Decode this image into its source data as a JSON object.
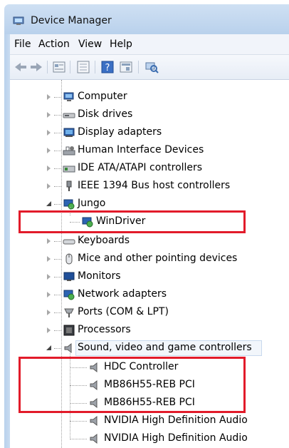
{
  "window": {
    "title": "Device Manager"
  },
  "menu": [
    "File",
    "Action",
    "View",
    "Help"
  ],
  "toolbar_icons": [
    "back-arrow-icon",
    "forward-arrow-icon",
    "properties-sheet-icon",
    "show-hidden-icon",
    "help-icon",
    "view-toggle-icon",
    "scan-hardware-icon"
  ],
  "tree": [
    {
      "label": "Computer",
      "icon": "computer-icon"
    },
    {
      "label": "Disk drives",
      "icon": "disk-drive-icon"
    },
    {
      "label": "Display adapters",
      "icon": "display-adapter-icon"
    },
    {
      "label": "Human Interface Devices",
      "icon": "hid-icon"
    },
    {
      "label": "IDE ATA/ATAPI controllers",
      "icon": "ide-controller-icon"
    },
    {
      "label": "IEEE 1394 Bus host controllers",
      "icon": "ieee1394-icon"
    },
    {
      "label": "Jungo",
      "icon": "jungo-icon",
      "expanded": true
    },
    {
      "label": "WinDriver",
      "icon": "windriver-icon",
      "child": true
    },
    {
      "label": "Keyboards",
      "icon": "keyboard-icon"
    },
    {
      "label": "Mice and other pointing devices",
      "icon": "mouse-icon"
    },
    {
      "label": "Monitors",
      "icon": "monitor-icon"
    },
    {
      "label": "Network adapters",
      "icon": "network-adapter-icon"
    },
    {
      "label": "Ports (COM & LPT)",
      "icon": "port-icon"
    },
    {
      "label": "Processors",
      "icon": "processor-icon"
    },
    {
      "label": "Sound, video and game controllers",
      "icon": "speaker-icon",
      "expanded": true,
      "selected": true
    },
    {
      "label": "HDC Controller",
      "icon": "speaker-icon",
      "child": true
    },
    {
      "label": "MB86H55-REB PCI",
      "icon": "speaker-icon",
      "child": true
    },
    {
      "label": "MB86H55-REB PCI",
      "icon": "speaker-icon",
      "child": true
    },
    {
      "label": "NVIDIA High Definition Audio",
      "icon": "speaker-icon",
      "child": true
    },
    {
      "label": "NVIDIA High Definition Audio",
      "icon": "speaker-icon",
      "child": true
    }
  ],
  "colors": {
    "highlight_box": "#e21b2a",
    "titlebar": "#b9d1ec"
  }
}
